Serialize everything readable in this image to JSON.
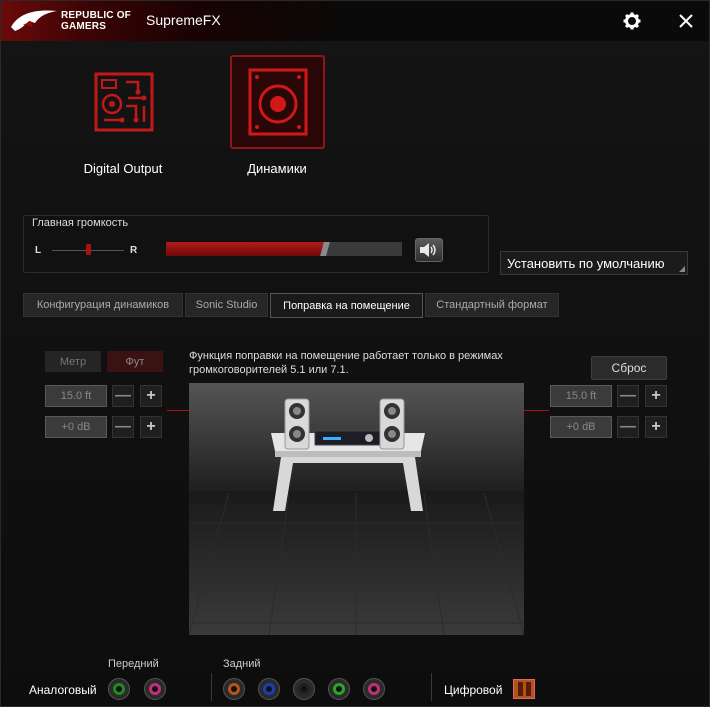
{
  "titlebar": {
    "brand_line1": "REPUBLIC OF",
    "brand_line2": "GAMERS",
    "app_title": "SupremeFX",
    "settings_icon": "gear-icon",
    "close_icon": "close-icon"
  },
  "devices": [
    {
      "label": "Digital Output",
      "icon": "digital-output-icon",
      "selected": false
    },
    {
      "label": "Динамики",
      "icon": "speaker-icon",
      "selected": true
    }
  ],
  "volume": {
    "title": "Главная громкость",
    "balance_left": "L",
    "balance_right": "R",
    "balance_value": 0.5,
    "level": 0.67,
    "mute_icon": "speaker-volume-icon"
  },
  "default_button": "Установить по умолчанию",
  "tabs": [
    {
      "label": "Конфигурация динамиков",
      "active": false
    },
    {
      "label": "Sonic Studio",
      "active": false
    },
    {
      "label": "Поправка на помещение",
      "active": true
    },
    {
      "label": "Стандартный формат",
      "active": false
    }
  ],
  "room_correction": {
    "unit_meter": "Метр",
    "unit_foot": "Фут",
    "description": "Функция поправки на помещение работает только в режимах громкоговорителей 5.1 или 7.1.",
    "reset_label": "Сброс",
    "left_distance": "15.0 ft",
    "left_gain": "+0 dB",
    "right_distance": "15.0 ft",
    "right_gain": "+0 dB",
    "minus": "—",
    "plus": "+"
  },
  "jacks": {
    "analog_label": "Аналоговый",
    "front_label": "Передний",
    "rear_label": "Задний",
    "digital_label": "Цифровой",
    "front_colors": [
      "#1f8a1f",
      "#c0307a"
    ],
    "rear_colors": [
      "#b5541a",
      "#1a3fb5",
      "#222222",
      "#2aa52a",
      "#c0307a"
    ]
  }
}
